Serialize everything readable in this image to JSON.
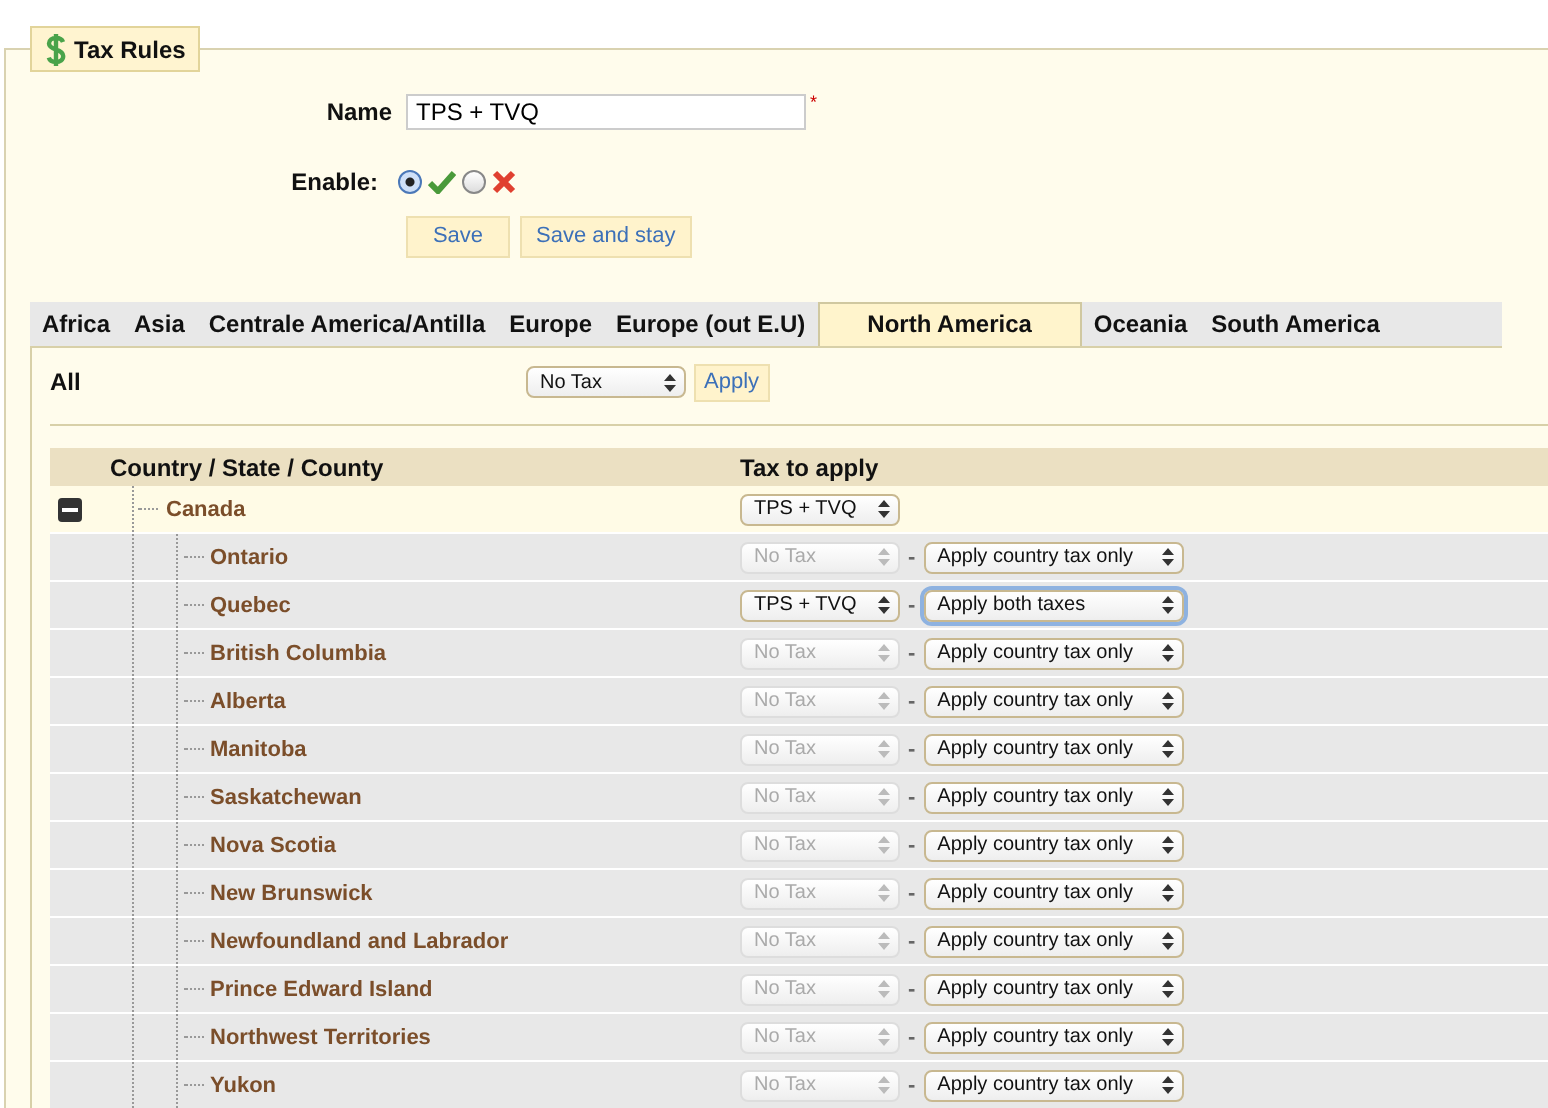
{
  "legend": {
    "title": "Tax Rules"
  },
  "form": {
    "name_label": "Name",
    "name_value": "TPS + TVQ",
    "required_mark": "*",
    "enable_label": "Enable:",
    "enabled": true,
    "buttons": [
      "Save",
      "Save and stay"
    ]
  },
  "tabs": [
    {
      "label": "Africa",
      "selected": false
    },
    {
      "label": "Asia",
      "selected": false
    },
    {
      "label": "Centrale America/Antilla",
      "selected": false
    },
    {
      "label": "Europe",
      "selected": false
    },
    {
      "label": "Europe (out E.U)",
      "selected": false
    },
    {
      "label": "North America",
      "selected": true
    },
    {
      "label": "Oceania",
      "selected": false
    },
    {
      "label": "South America",
      "selected": false
    }
  ],
  "all_row": {
    "label": "All",
    "select": "No Tax",
    "button": "Apply"
  },
  "table": {
    "columns": [
      "Country / State / County",
      "Tax to apply"
    ],
    "country": {
      "name": "Canada",
      "expanded": true,
      "tax": "TPS + TVQ",
      "children": [
        {
          "name": "Ontario",
          "tax": "No Tax",
          "disabled": true,
          "separator": "-",
          "behavior": "Apply country tax only",
          "focused": false
        },
        {
          "name": "Quebec",
          "tax": "TPS + TVQ",
          "disabled": false,
          "separator": "-",
          "behavior": "Apply both taxes",
          "focused": true
        },
        {
          "name": "British Columbia",
          "tax": "No Tax",
          "disabled": true,
          "separator": "-",
          "behavior": "Apply country tax only",
          "focused": false
        },
        {
          "name": "Alberta",
          "tax": "No Tax",
          "disabled": true,
          "separator": "-",
          "behavior": "Apply country tax only",
          "focused": false
        },
        {
          "name": "Manitoba",
          "tax": "No Tax",
          "disabled": true,
          "separator": "-",
          "behavior": "Apply country tax only",
          "focused": false
        },
        {
          "name": "Saskatchewan",
          "tax": "No Tax",
          "disabled": true,
          "separator": "-",
          "behavior": "Apply country tax only",
          "focused": false
        },
        {
          "name": "Nova Scotia",
          "tax": "No Tax",
          "disabled": true,
          "separator": "-",
          "behavior": "Apply country tax only",
          "focused": false
        },
        {
          "name": "New Brunswick",
          "tax": "No Tax",
          "disabled": true,
          "separator": "-",
          "behavior": "Apply country tax only",
          "focused": false
        },
        {
          "name": "Newfoundland and Labrador",
          "tax": "No Tax",
          "disabled": true,
          "separator": "-",
          "behavior": "Apply country tax only",
          "focused": false
        },
        {
          "name": "Prince Edward Island",
          "tax": "No Tax",
          "disabled": true,
          "separator": "-",
          "behavior": "Apply country tax only",
          "focused": false
        },
        {
          "name": "Northwest Territories",
          "tax": "No Tax",
          "disabled": true,
          "separator": "-",
          "behavior": "Apply country tax only",
          "focused": false
        },
        {
          "name": "Yukon",
          "tax": "No Tax",
          "disabled": true,
          "separator": "-",
          "behavior": "Apply country tax only",
          "focused": false
        }
      ]
    }
  }
}
